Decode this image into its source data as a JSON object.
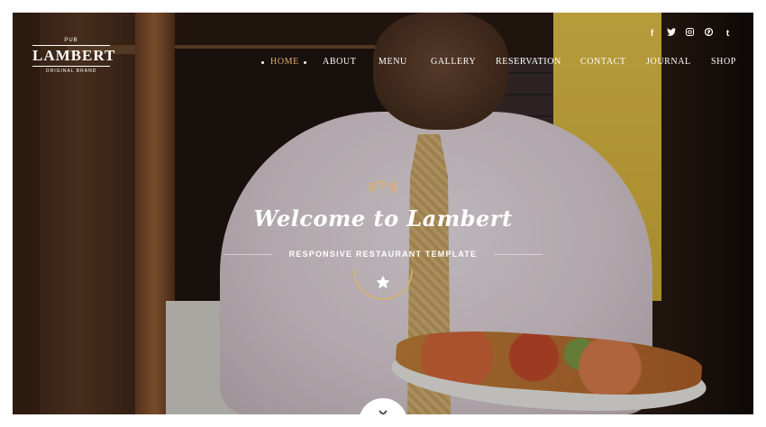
{
  "logo": {
    "pub": "PUB",
    "name": "LAMBERT",
    "brand": "ORIGINAL BRAND"
  },
  "social": [
    {
      "icon": "facebook-icon",
      "glyph": "f"
    },
    {
      "icon": "twitter-icon",
      "glyph": "🐦"
    },
    {
      "icon": "instagram-icon",
      "glyph": "◘"
    },
    {
      "icon": "pinterest-icon",
      "glyph": "℗"
    },
    {
      "icon": "tumblr-icon",
      "glyph": "t"
    }
  ],
  "nav": {
    "items": [
      {
        "label": "HOME",
        "active": true
      },
      {
        "label": "ABOUT"
      },
      {
        "label": "MENU"
      },
      {
        "label": "GALLERY"
      },
      {
        "label": "RESERVATION"
      },
      {
        "label": "CONTACT"
      },
      {
        "label": "JOURNAL"
      },
      {
        "label": "SHOP"
      }
    ]
  },
  "hero": {
    "title": "Welcome to Lambert",
    "subtitle": "RESPONSIVE RESTAURANT TEMPLATE",
    "star_icon": "star-icon",
    "scroll_icon": "chevron-double-down-icon"
  },
  "colors": {
    "accent": "#e0b06a",
    "text": "#ffffff"
  }
}
